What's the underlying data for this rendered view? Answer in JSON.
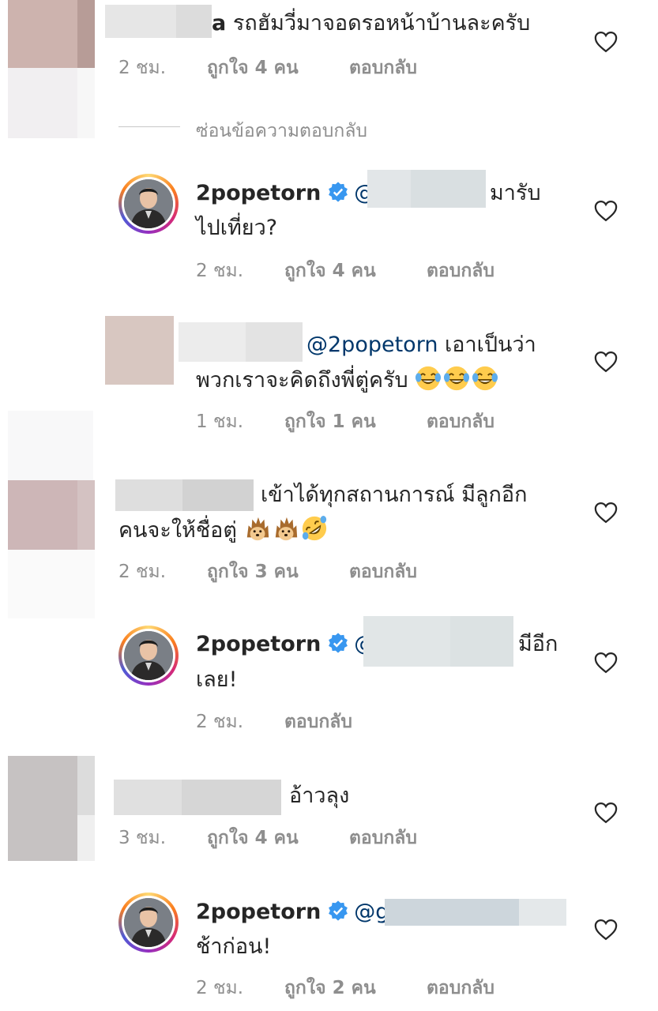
{
  "hide_replies": "ซ่อนข้อความตอบกลับ",
  "verified_name": "2popetorn",
  "comments": [
    {
      "tail": "a",
      "text": "รถฮัมวี่มาจอดรอหน้าบ้านละครับ",
      "time": "2 ชม.",
      "likes": "ถูกใจ 4 คน",
      "reply": "ตอบกลับ"
    },
    {
      "username": "2popetorn",
      "mention": "@",
      "line1_tail": "มารับ",
      "line2": "ไปเที่ยว?",
      "time": "2 ชม.",
      "likes": "ถูกใจ 4 คน",
      "reply": "ตอบกลับ"
    },
    {
      "mention": "@2popetorn",
      "line1_tail": "เอาเป็นว่า",
      "line2": "พวกเราจะคิดถึงพี่ตู่ครับ",
      "emojis": [
        "face-with-tears-of-joy",
        "face-with-tears-of-joy",
        "face-with-tears-of-joy"
      ],
      "time": "1 ชม.",
      "likes": "ถูกใจ 1 คน",
      "reply": "ตอบกลับ"
    },
    {
      "line1": "เข้าได้ทุกสถานการณ์ มีลูกอีก",
      "line2": "คนจะให้ชื่อตู่",
      "emojis": [
        "hedgehog",
        "hedgehog",
        "rolling-on-floor-laughing"
      ],
      "time": "2 ชม.",
      "likes": "ถูกใจ 3 คน",
      "reply": "ตอบกลับ"
    },
    {
      "username": "2popetorn",
      "mention": "@",
      "line1_tail": "มีอีก",
      "line2": "เลย!",
      "time": "2 ชม.",
      "reply": "ตอบกลับ"
    },
    {
      "text": "อ้าวลุง",
      "time": "3 ชม.",
      "likes": "ถูกใจ 4 คน",
      "reply": "ตอบกลับ"
    },
    {
      "username": "2popetorn",
      "mention": "@g",
      "line2": "ช้าก่อน!",
      "time": "2 ชม.",
      "likes": "ถูกใจ 2 คน",
      "reply": "ตอบกลับ"
    }
  ],
  "colors": {
    "text": "#262626",
    "meta": "#8e8e8e",
    "mention": "#00376b",
    "verified": "#3897f0"
  }
}
